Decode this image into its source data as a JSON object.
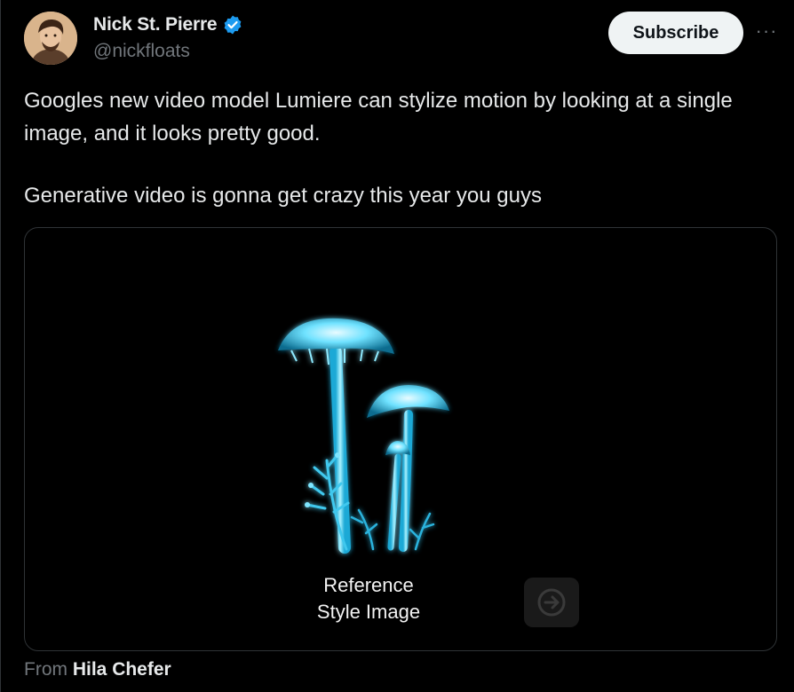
{
  "author": {
    "name": "Nick St. Pierre",
    "handle": "@nickfloats",
    "verified": true
  },
  "actions": {
    "subscribe_label": "Subscribe",
    "more_label": "···"
  },
  "post": {
    "paragraph_1": "Googles new video model Lumiere can stylize motion by looking at a single image, and it looks pretty good.",
    "paragraph_2": "Generative video is gonna get crazy this year you guys"
  },
  "media": {
    "caption_line_1": "Reference",
    "caption_line_2": "Style Image"
  },
  "attribution": {
    "prefix": "From",
    "source": "Hila Chefer"
  },
  "colors": {
    "background": "#000000",
    "text": "#e7e9ea",
    "secondary": "#71767b",
    "verified": "#1d9bf0",
    "mushroom_glow": "#4fd8ff"
  }
}
